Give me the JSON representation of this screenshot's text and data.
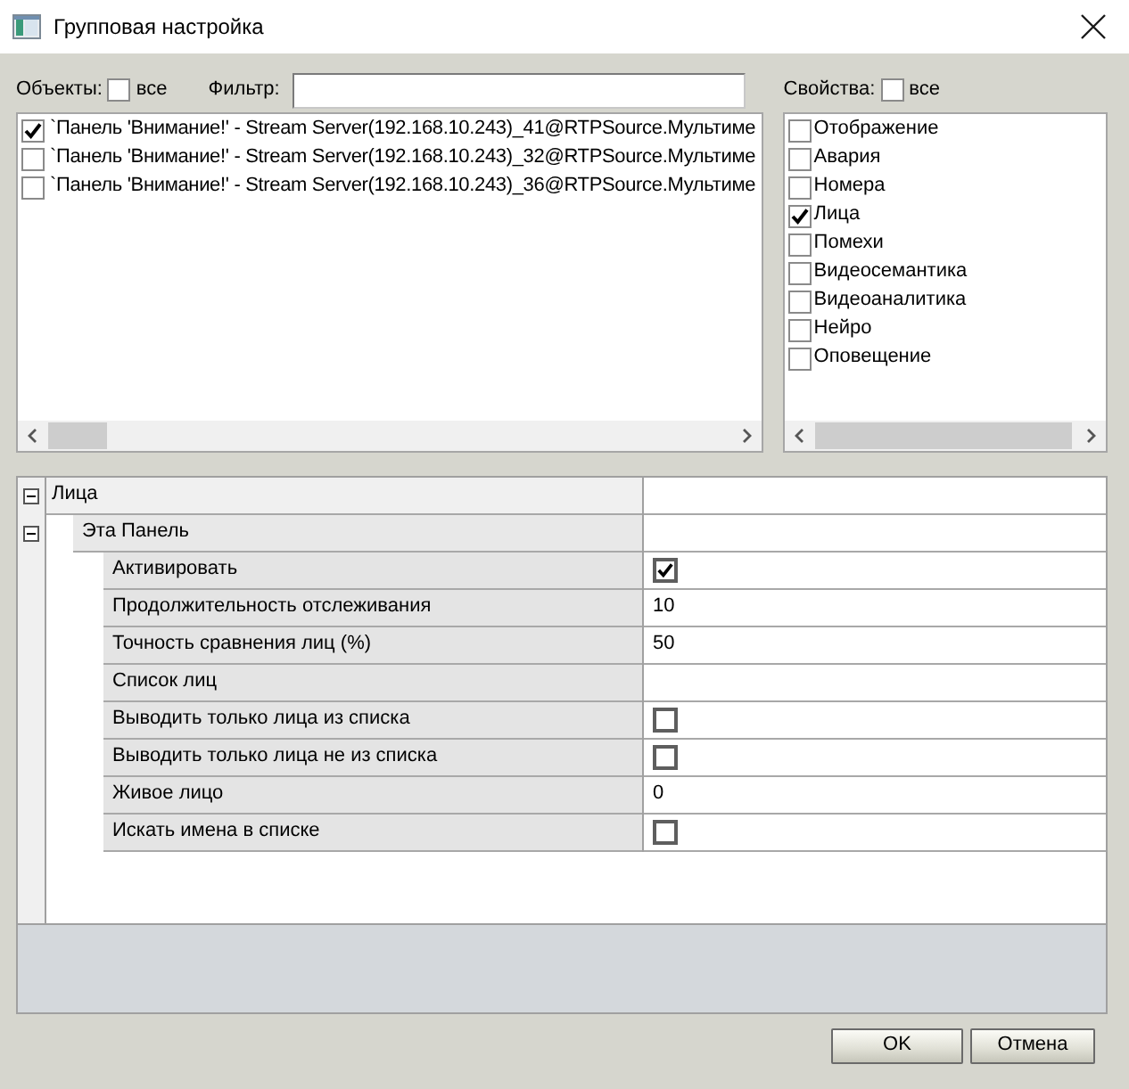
{
  "window": {
    "title": "Групповая настройка"
  },
  "objects": {
    "label": "Объекты:",
    "all_label": "все",
    "all_checked": false,
    "items": [
      {
        "text": "`Панель 'Внимание!' - Stream Server(192.168.10.243)_41@RTPSource.Мультиме",
        "checked": true
      },
      {
        "text": "`Панель 'Внимание!' - Stream Server(192.168.10.243)_32@RTPSource.Мультиме",
        "checked": false
      },
      {
        "text": "`Панель 'Внимание!' - Stream Server(192.168.10.243)_36@RTPSource.Мультиме",
        "checked": false
      }
    ]
  },
  "filter": {
    "label": "Фильтр:"
  },
  "properties": {
    "label": "Свойства:",
    "all_label": "все",
    "all_checked": false,
    "items": [
      {
        "text": "Отображение",
        "checked": false
      },
      {
        "text": "Авария",
        "checked": false
      },
      {
        "text": "Номера",
        "checked": false
      },
      {
        "text": "Лица",
        "checked": true
      },
      {
        "text": "Помехи",
        "checked": false
      },
      {
        "text": "Видеосемантика",
        "checked": false
      },
      {
        "text": "Видеоаналитика",
        "checked": false
      },
      {
        "text": "Нейро",
        "checked": false
      },
      {
        "text": "Оповещение",
        "checked": false
      }
    ]
  },
  "property_grid": {
    "categories": [
      {
        "name": "Лица",
        "expanded": true,
        "children": [
          {
            "name": "Эта Панель",
            "expanded": true,
            "children": [
              {
                "name": "Активировать",
                "kind": "checkbox",
                "checked": true
              },
              {
                "name": "Продолжительность отслеживания",
                "kind": "text",
                "value": "10"
              },
              {
                "name": "Точность сравнения лиц (%)",
                "kind": "text",
                "value": "50"
              },
              {
                "name": "Список лиц",
                "kind": "text"
              },
              {
                "name": "Выводить только лица из списка",
                "kind": "checkbox",
                "checked": false
              },
              {
                "name": "Выводить только лица не из списка",
                "kind": "checkbox",
                "checked": false
              },
              {
                "name": "Живое лицо",
                "kind": "text",
                "value": "0"
              },
              {
                "name": "Искать имена в списке",
                "kind": "checkbox",
                "checked": false
              }
            ]
          }
        ]
      }
    ]
  },
  "buttons": [
    {
      "label": "OK"
    },
    {
      "label": "Отмена"
    }
  ]
}
